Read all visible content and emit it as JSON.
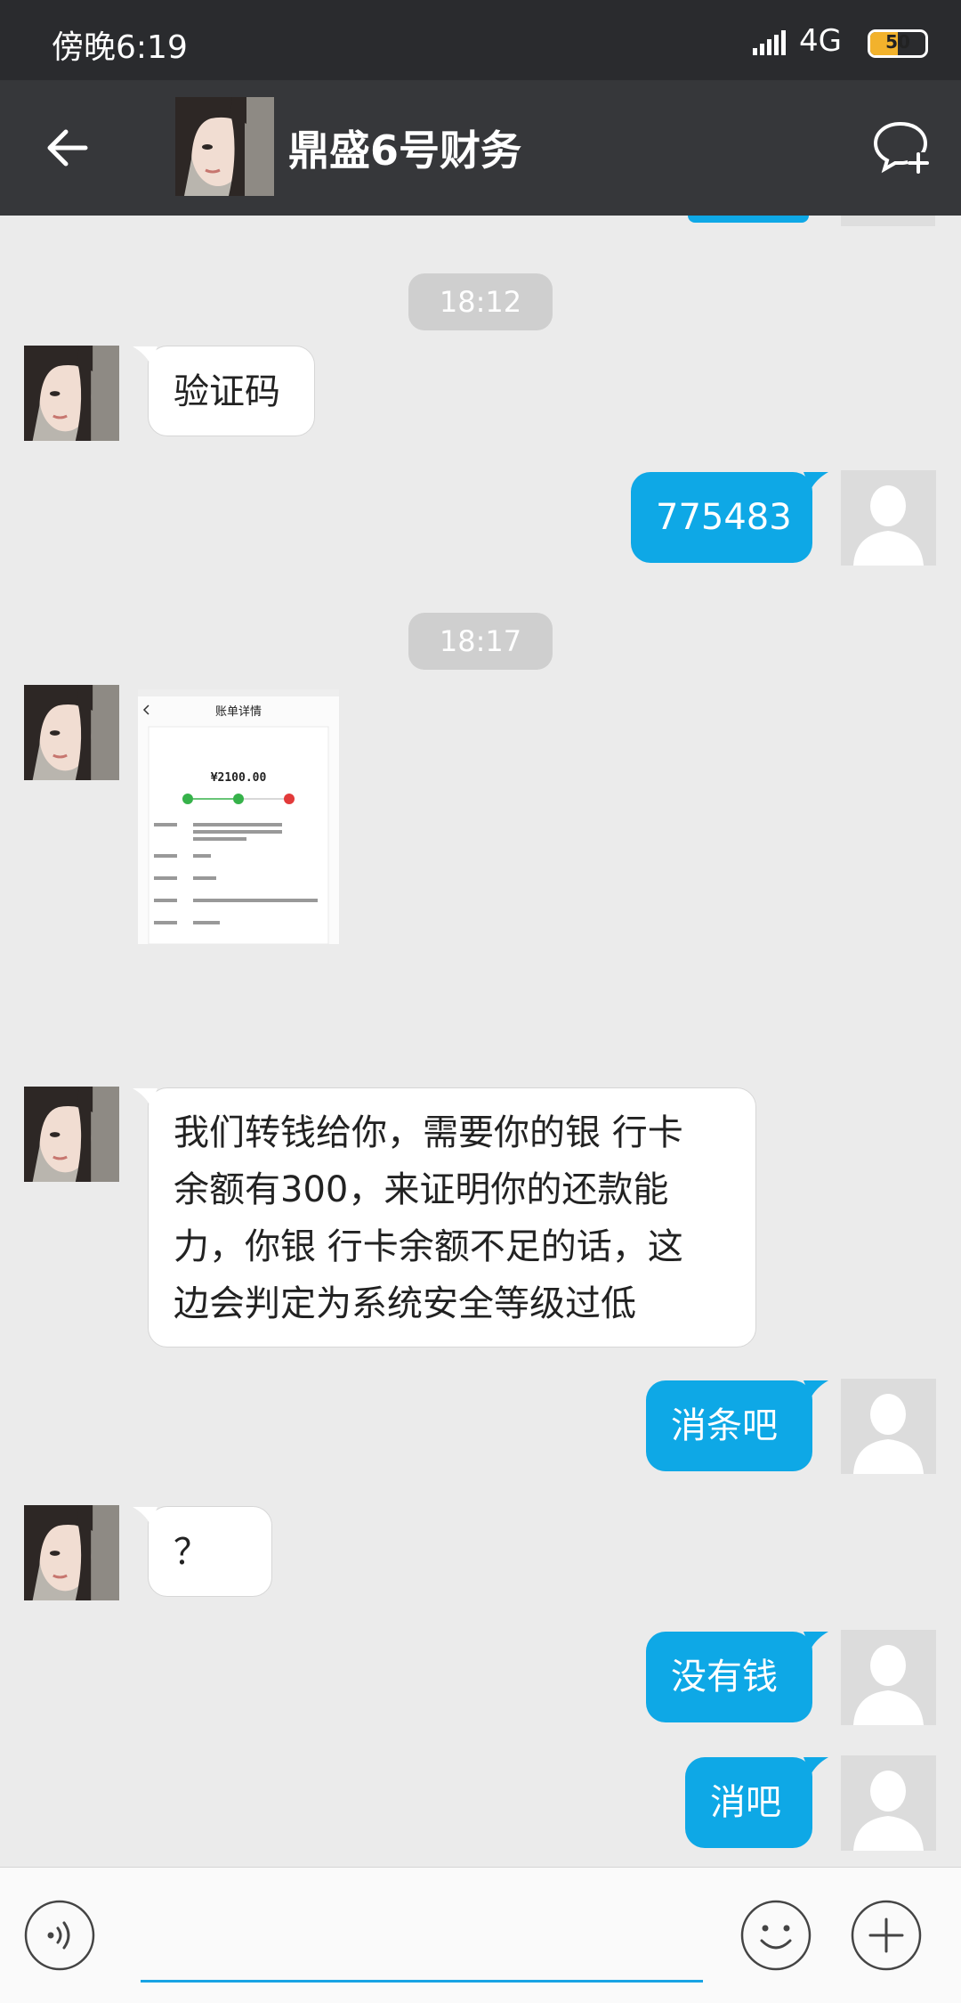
{
  "status_bar": {
    "time": "傍晚6:19",
    "network": "4G",
    "battery": "50",
    "battery_level": 0.5
  },
  "header": {
    "title": "鼎盛6号财务"
  },
  "messages": {
    "time1": "18:12",
    "m1": "验证码",
    "m2": "775483",
    "time2": "18:17",
    "m4_lines": [
      "我们转钱给你，需要你的银 行卡",
      "余额有300，来证明你的还款能",
      "力，你银 行卡余额不足的话，这",
      "边会判定为系统安全等级过低"
    ],
    "m5": "消条吧",
    "m6": "？",
    "m7": "没有钱",
    "m8": "消吧"
  },
  "screenshot_image": {
    "title": "账单详情",
    "amount": "¥2100.00"
  },
  "input": {
    "placeholder": ""
  },
  "colors": {
    "accent": "#0ea8e6",
    "header_bg": "#36373a",
    "status_bg": "#2a2b2e",
    "chat_bg": "#ebebeb"
  }
}
